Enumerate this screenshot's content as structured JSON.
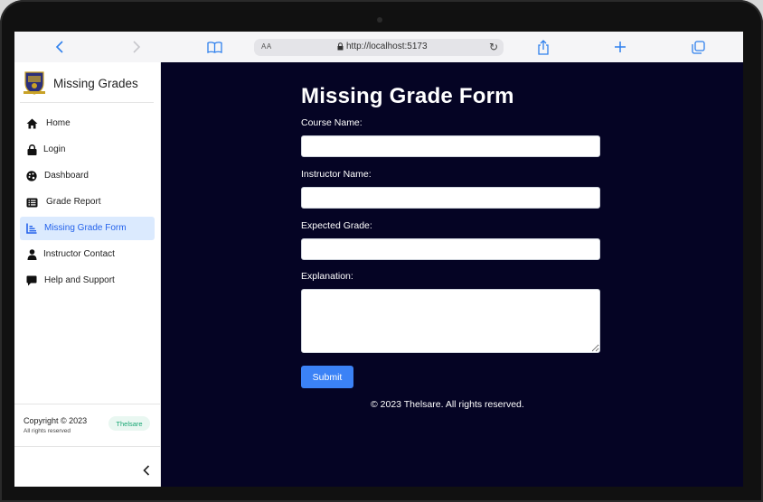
{
  "browser": {
    "text_size_label": "AA",
    "url": "http://localhost:5173",
    "accent_color": "#2f80ed"
  },
  "sidebar": {
    "app_title": "Missing Grades",
    "items": [
      {
        "label": "Home",
        "icon": "home-icon",
        "active": false
      },
      {
        "label": "Login",
        "icon": "lock-icon",
        "active": false
      },
      {
        "label": "Dashboard",
        "icon": "palette-icon",
        "active": false
      },
      {
        "label": "Grade Report",
        "icon": "list-icon",
        "active": false
      },
      {
        "label": "Missing Grade Form",
        "icon": "chart-icon",
        "active": true
      },
      {
        "label": "Instructor Contact",
        "icon": "person-icon",
        "active": false
      },
      {
        "label": "Help and Support",
        "icon": "chat-icon",
        "active": false
      }
    ],
    "footer": {
      "copyright": "Copyright © 2023",
      "rights": "All rights reserved",
      "badge": "Thelsare"
    }
  },
  "main": {
    "title": "Missing Grade Form",
    "fields": [
      {
        "label": "Course Name:",
        "value": ""
      },
      {
        "label": "Instructor Name:",
        "value": ""
      },
      {
        "label": "Expected Grade:",
        "value": ""
      },
      {
        "label": "Explanation:",
        "value": ""
      }
    ],
    "submit_label": "Submit",
    "footer": "© 2023 Thelsare. All rights reserved.",
    "background_color": "#050424"
  }
}
